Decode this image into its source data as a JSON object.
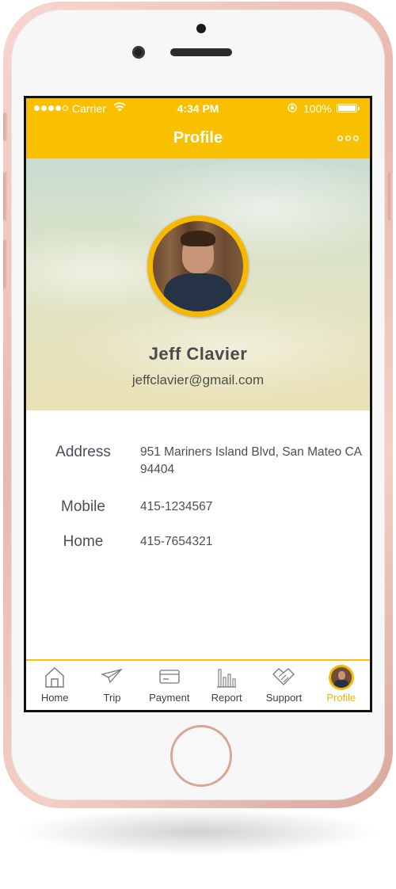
{
  "status_bar": {
    "carrier": "Carrier",
    "time": "4:34 PM",
    "battery": "100%"
  },
  "nav": {
    "title": "Profile",
    "more_icon": "more-dots-icon"
  },
  "profile": {
    "name": "Jeff Clavier",
    "email": "jeffclavier@gmail.com"
  },
  "details": [
    {
      "label": "Address",
      "value": "951 Mariners Island Blvd, San Mateo CA 94404"
    },
    {
      "label": "Mobile",
      "value": "415-1234567"
    },
    {
      "label": "Home",
      "value": "415-7654321"
    }
  ],
  "tabs": [
    {
      "label": "Home",
      "icon": "house-icon"
    },
    {
      "label": "Trip",
      "icon": "paper-plane-icon"
    },
    {
      "label": "Payment",
      "icon": "credit-card-icon"
    },
    {
      "label": "Report",
      "icon": "bar-chart-icon"
    },
    {
      "label": "Support",
      "icon": "handshake-icon"
    },
    {
      "label": "Profile",
      "icon": "avatar-icon",
      "active": true
    }
  ],
  "colors": {
    "accent": "#f9c000",
    "active_tab": "#f3b400",
    "text": "#4a4f57"
  }
}
